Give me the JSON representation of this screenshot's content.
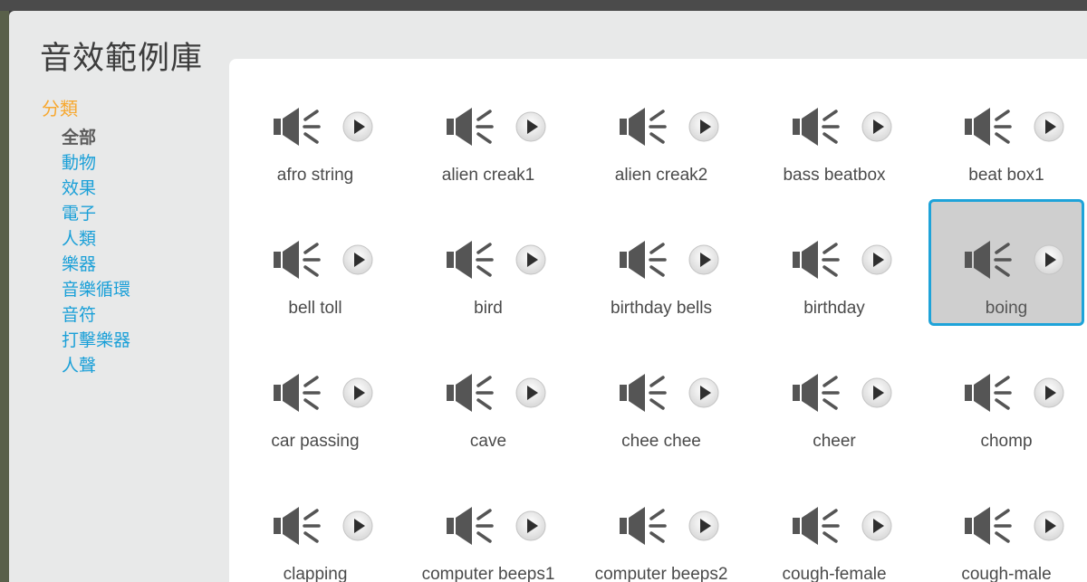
{
  "dialog": {
    "title": "音效範例庫"
  },
  "sidebar": {
    "heading": "分類",
    "categories": [
      {
        "label": "全部",
        "active": true
      },
      {
        "label": "動物"
      },
      {
        "label": "效果"
      },
      {
        "label": "電子"
      },
      {
        "label": "人類"
      },
      {
        "label": "樂器"
      },
      {
        "label": "音樂循環"
      },
      {
        "label": "音符"
      },
      {
        "label": "打擊樂器"
      },
      {
        "label": "人聲"
      }
    ]
  },
  "sounds": [
    {
      "name": "afro string"
    },
    {
      "name": "alien creak1"
    },
    {
      "name": "alien creak2"
    },
    {
      "name": "bass beatbox"
    },
    {
      "name": "beat box1"
    },
    {
      "name": "bell toll"
    },
    {
      "name": "bird"
    },
    {
      "name": "birthday bells"
    },
    {
      "name": "birthday"
    },
    {
      "name": "boing",
      "selected": true
    },
    {
      "name": "car passing"
    },
    {
      "name": "cave"
    },
    {
      "name": "chee chee"
    },
    {
      "name": "cheer"
    },
    {
      "name": "chomp"
    },
    {
      "name": "clapping"
    },
    {
      "name": "computer beeps1"
    },
    {
      "name": "computer beeps2"
    },
    {
      "name": "cough-female"
    },
    {
      "name": "cough-male"
    }
  ],
  "icons": {
    "sound": "speaker-icon",
    "play": "play-icon"
  },
  "colors": {
    "accent": "#1ea3d9",
    "heading": "#f7a830",
    "link": "#1ba0d8",
    "selected_bg": "#cfcfcf"
  }
}
